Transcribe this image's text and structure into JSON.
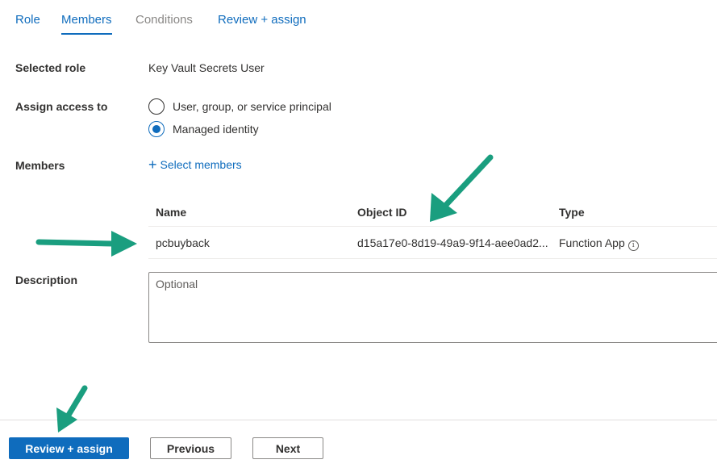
{
  "tabs": [
    {
      "label": "Role",
      "state": "link"
    },
    {
      "label": "Members",
      "state": "active"
    },
    {
      "label": "Conditions",
      "state": "disabled"
    },
    {
      "label": "Review + assign",
      "state": "link"
    }
  ],
  "selected_role": {
    "label": "Selected role",
    "value": "Key Vault Secrets User"
  },
  "assign_access": {
    "label": "Assign access to",
    "options": [
      {
        "label": "User, group, or service principal",
        "checked": false
      },
      {
        "label": "Managed identity",
        "checked": true
      }
    ]
  },
  "members": {
    "label": "Members",
    "select_link": "Select members",
    "columns": [
      "Name",
      "Object ID",
      "Type"
    ],
    "rows": [
      {
        "name": "pcbuyback",
        "object_id": "d15a17e0-8d19-49a9-9f14-aee0ad2...",
        "type": "Function App"
      }
    ]
  },
  "description": {
    "label": "Description",
    "placeholder": "Optional"
  },
  "footer": {
    "review_assign": "Review + assign",
    "previous": "Previous",
    "next": "Next"
  },
  "annotation_color": "#1a9e7f",
  "accent_color": "#0f6cbd"
}
